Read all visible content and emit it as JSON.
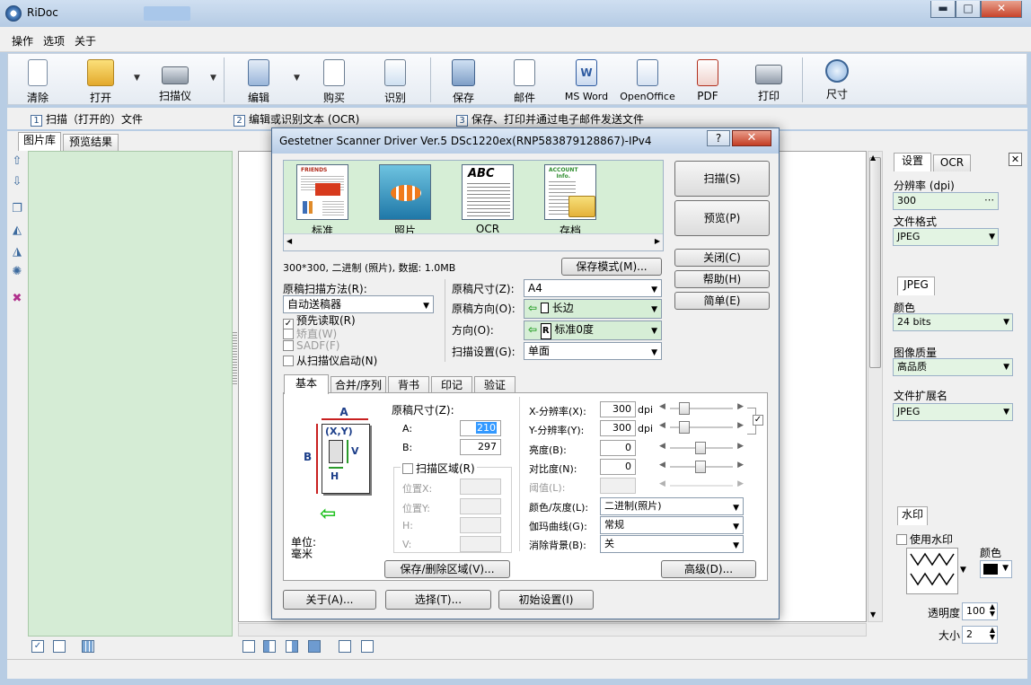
{
  "app": {
    "title": "RiDoc"
  },
  "window_buttons": {
    "minimize": "▬",
    "maximize": "□",
    "close": "✕"
  },
  "menu": [
    "操作",
    "选项",
    "关于"
  ],
  "toolbar": {
    "buttons": [
      {
        "label": "清除",
        "icon": "blank-page-icon"
      },
      {
        "label": "打开",
        "icon": "open-folder-icon"
      },
      {
        "label": "扫描仪",
        "icon": "scanner-icon"
      },
      {
        "label": "编辑",
        "icon": "edit-document-icon"
      },
      {
        "label": "购买",
        "icon": "buy-icon"
      },
      {
        "label": "识别",
        "icon": "recognize-icon"
      },
      {
        "label": "保存",
        "icon": "save-icon"
      },
      {
        "label": "邮件",
        "icon": "mail-icon"
      },
      {
        "label": "MS Word",
        "icon": "word-icon"
      },
      {
        "label": "OpenOffice",
        "icon": "openoffice-icon"
      },
      {
        "label": "PDF",
        "icon": "pdf-icon"
      },
      {
        "label": "打印",
        "icon": "printer-icon"
      },
      {
        "label": "尺寸",
        "icon": "magnifier-icon"
      }
    ]
  },
  "steps": [
    {
      "num": "1",
      "text": "扫描（打开的）文件"
    },
    {
      "num": "2",
      "text": "编辑或识别文本 (OCR)"
    },
    {
      "num": "3",
      "text": "保存、打印并通过电子邮件发送文件"
    }
  ],
  "left_tabs": [
    "图片库",
    "预览结果"
  ],
  "right_panel": {
    "tabs": [
      "设置",
      "OCR"
    ],
    "resolution_label": "分辨率 (dpi)",
    "resolution_value": "300",
    "format_label": "文件格式",
    "format_value": "JPEG",
    "jpeg_tab": "JPEG",
    "color_label": "颜色",
    "color_value": "24 bits",
    "quality_label": "图像质量",
    "quality_value": "高品质",
    "ext_label": "文件扩展名",
    "ext_value": "JPEG",
    "watermark_tab": "水印",
    "use_watermark": "使用水印",
    "wm_color_label": "颜色",
    "opacity_label": "透明度",
    "opacity_value": "100",
    "size_label": "大小",
    "size_value": "2"
  },
  "dialog": {
    "title": "Gestetner Scanner Driver Ver.5 DSc1220ex(RNP583879128867)-IPv4",
    "help": "?",
    "close": "✕",
    "modes": [
      {
        "label": "标准"
      },
      {
        "label": "照片"
      },
      {
        "label": "OCR"
      },
      {
        "label": "存档"
      }
    ],
    "mode_art": {
      "standard": "FRIENDS",
      "ocr": "ABC",
      "archive": "ACCOUNT\nInfo."
    },
    "info_text": "300*300, 二进制 (照片), 数据: 1.0MB",
    "save_mode_btn": "保存模式(M)...",
    "scan_btn": "扫描(S)",
    "preview_btn": "预览(P)",
    "close_btn": "关闭(C)",
    "help_btn": "帮助(H)",
    "simple_btn": "简单(E)",
    "scan_method_label": "原稿扫描方法(R):",
    "scan_method_value": "自动送稿器",
    "prescan": "预先读取(R)",
    "deskew": "矫直(W)",
    "sadf": "SADF(F)",
    "from_scanner": "从扫描仪启动(N)",
    "orig_size_label": "原稿尺寸(Z):",
    "orig_size_value": "A4",
    "orig_dir_label": "原稿方向(O):",
    "orig_dir_value": "长边",
    "direction_label": "方向(O):",
    "direction_value": "标准0度",
    "scan_setting_label": "扫描设置(G):",
    "scan_setting_value": "单面",
    "tabs": [
      "基本",
      "合并/序列",
      "背书",
      "印记",
      "验证"
    ],
    "diagram": {
      "a": "A",
      "b": "B",
      "xy": "(X,Y)",
      "v": "V",
      "h": "H",
      "unit": "单位:\n毫米"
    },
    "size_label": "原稿尺寸(Z):",
    "a_label": "A:",
    "a_value": "210",
    "b_label": "B:",
    "b_value": "297",
    "scan_area": "扫描区域(R)",
    "pos_x": "位置X:",
    "pos_y": "位置Y:",
    "h_label": "H:",
    "v_label": "V:",
    "save_area_btn": "保存/删除区域(V)...",
    "xres_label": "X-分辨率(X):",
    "xres_value": "300",
    "yres_label": "Y-分辨率(Y):",
    "yres_value": "300",
    "dpi": "dpi",
    "brightness_label": "亮度(B):",
    "brightness_value": "0",
    "contrast_label": "对比度(N):",
    "contrast_value": "0",
    "threshold_label": "阈值(L):",
    "color_label": "颜色/灰度(L):",
    "color_value": "二进制(照片)",
    "gamma_label": "伽玛曲线(G):",
    "gamma_value": "常规",
    "bg_label": "消除背景(B):",
    "bg_value": "关",
    "advanced_btn": "高级(D)...",
    "about_btn": "关于(A)...",
    "select_btn": "选择(T)...",
    "init_btn": "初始设置(I)"
  }
}
